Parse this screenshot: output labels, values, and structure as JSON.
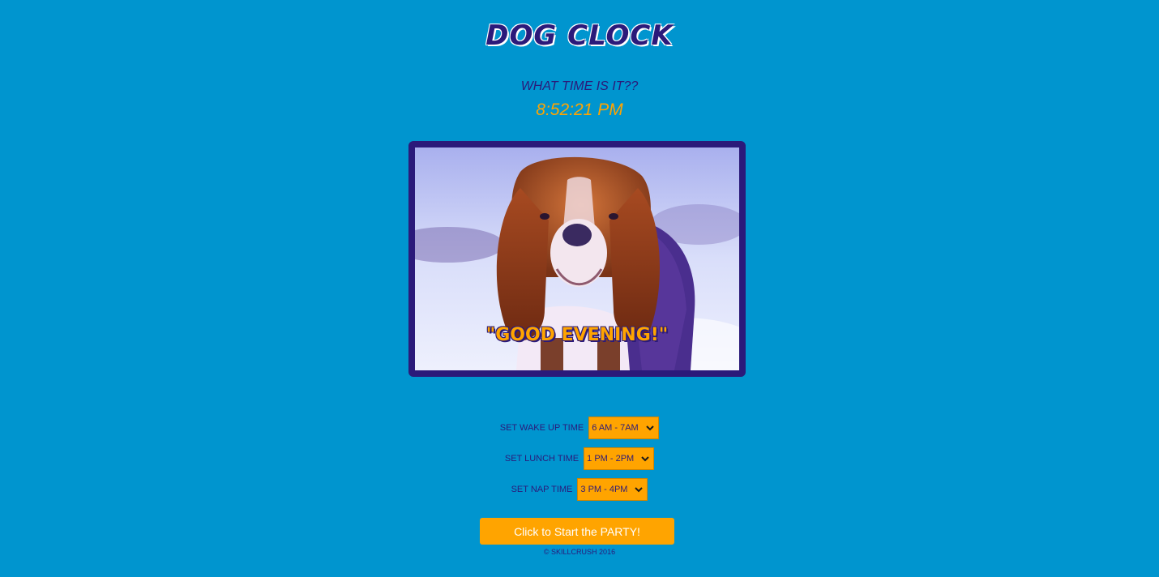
{
  "header": {
    "title": "DOG CLOCK"
  },
  "clock": {
    "question": "WHAT TIME IS IT??",
    "time": "8:52:21 PM"
  },
  "photo": {
    "caption": "\"GOOD EVENING!\""
  },
  "settings": [
    {
      "label": "SET WAKE UP TIME",
      "value": "6 AM - 7AM"
    },
    {
      "label": "SET LUNCH TIME",
      "value": "1 PM - 2PM"
    },
    {
      "label": "SET NAP TIME",
      "value": "3 PM - 4PM"
    }
  ],
  "party_button": {
    "label": "Click to Start the PARTY!"
  },
  "footer": {
    "copyright": "© SKILLCRUSH 2016"
  },
  "colors": {
    "background": "#0095cf",
    "primary": "#2b1a7a",
    "accent": "#ffa400",
    "text_light": "#ffffff"
  }
}
